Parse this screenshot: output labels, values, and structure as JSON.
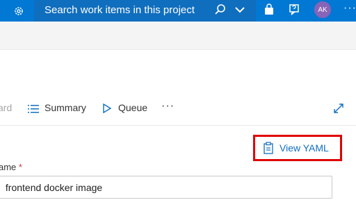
{
  "topbar": {
    "search_text": "Search work items in this project",
    "avatar_initials": "AK",
    "more_label": "···"
  },
  "tabs": {
    "cut_label": "ard",
    "summary_label": "Summary",
    "queue_label": "Queue",
    "more_label": "···"
  },
  "pipeline": {
    "view_yaml_label": "View YAML",
    "name_field_label": "ame",
    "required_marker": "*",
    "name_value": " frontend docker image"
  },
  "colors": {
    "topbar": "#0078d4",
    "search_bg": "#106ebe",
    "avatar": "#8764b8",
    "accent": "#106ebe",
    "highlight": "#e00000"
  }
}
